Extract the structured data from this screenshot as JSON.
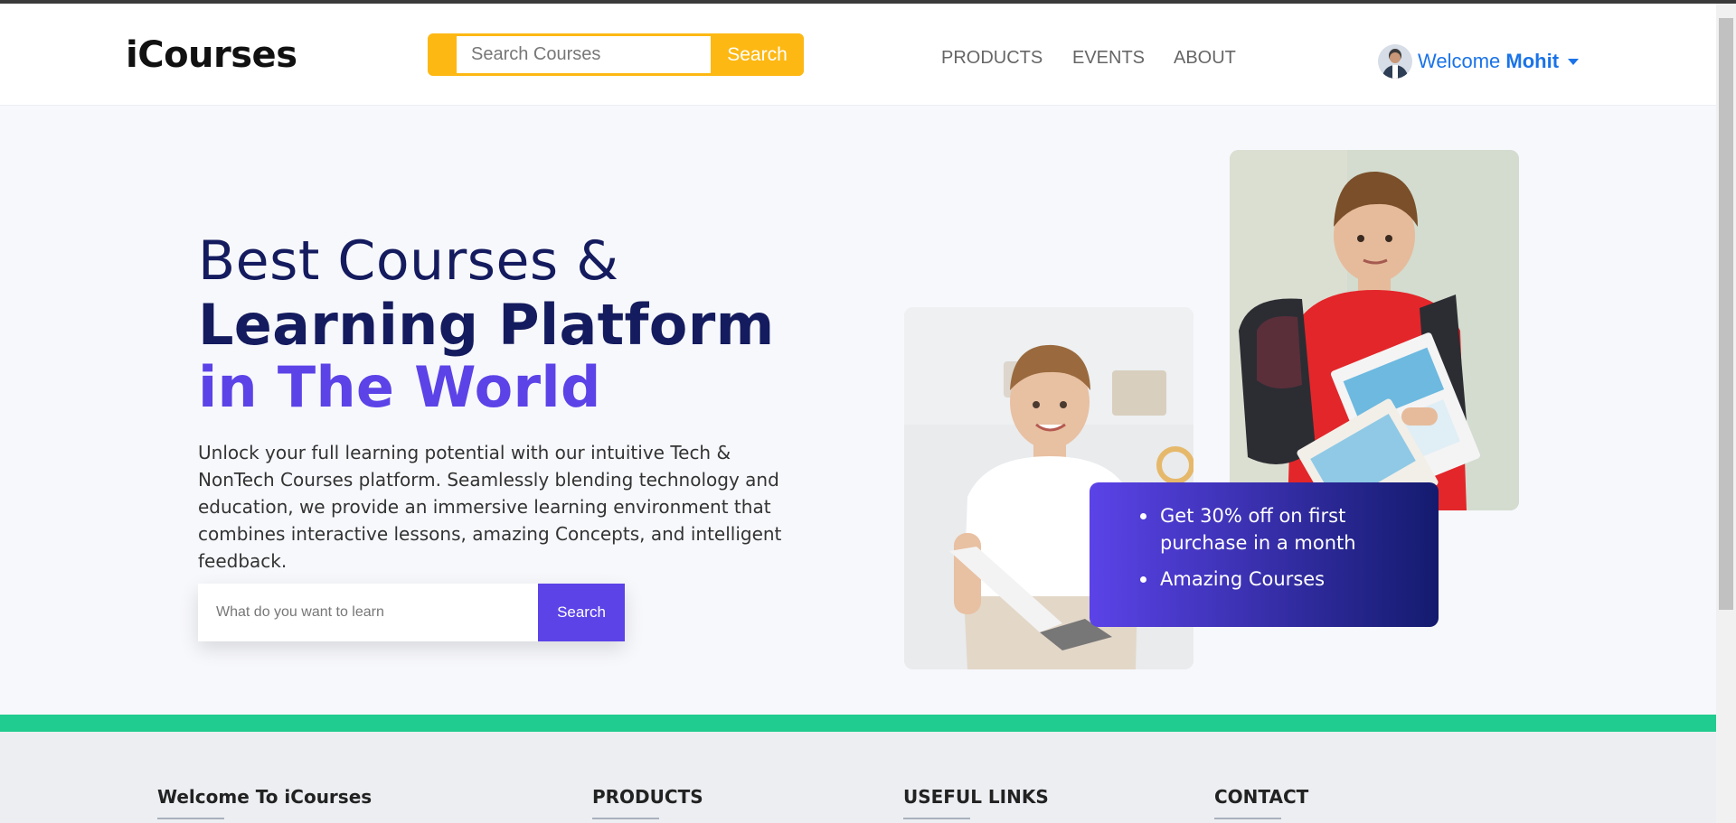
{
  "header": {
    "logo": "iCourses",
    "search_placeholder": "Search Courses",
    "search_button": "Search",
    "nav": {
      "products": "PRODUCTS",
      "events": "EVENTS",
      "about": "ABOUT"
    },
    "user": {
      "welcome": "Welcome",
      "name": "Mohit"
    }
  },
  "hero": {
    "line1": "Best Courses &",
    "line2": "Learning Platform",
    "line3": "in The World",
    "description": "Unlock your full learning potential with our intuitive Tech & NonTech Courses platform. Seamlessly blending technology and education, we provide an immersive learning environment that combines interactive lessons, amazing Concepts, and intelligent feedback.",
    "learn_placeholder": "What do you want to learn",
    "learn_button": "Search"
  },
  "offer": {
    "items": [
      "Get 30% off on first purchase in a month",
      "Amazing Courses"
    ]
  },
  "footer": {
    "col1": "Welcome To iCourses",
    "col2": "PRODUCTS",
    "col3": "USEFUL LINKS",
    "col4": "CONTACT"
  },
  "colors": {
    "accent_yellow": "#fdb813",
    "accent_purple": "#5b43e8",
    "navy": "#141b5e",
    "link_blue": "#1a73e8",
    "green_band": "#20cc8f"
  }
}
